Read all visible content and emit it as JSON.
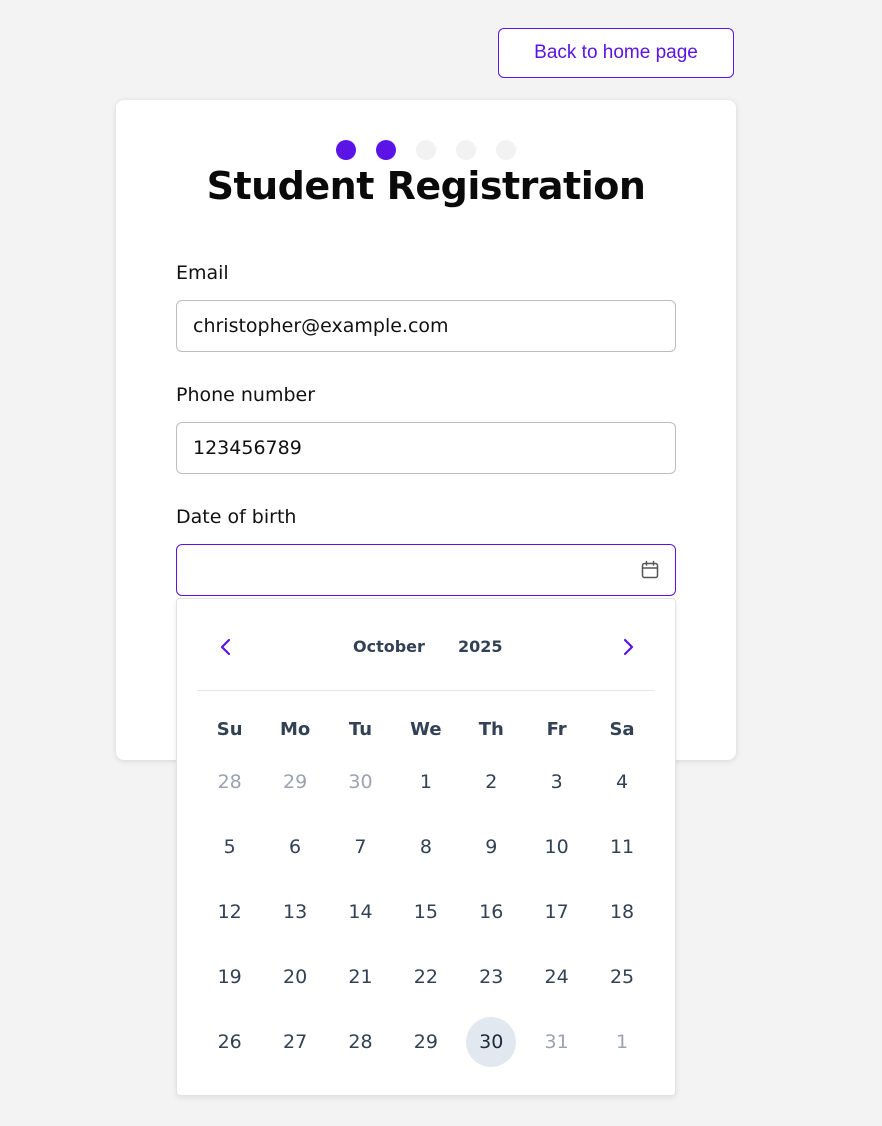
{
  "header": {
    "back_button_label": "Back to home page"
  },
  "form": {
    "title": "Student Registration",
    "steps_total": 5,
    "steps_completed": 2,
    "email": {
      "label": "Email",
      "value": "christopher@example.com"
    },
    "phone": {
      "label": "Phone number",
      "value": "123456789"
    },
    "dob": {
      "label": "Date of birth",
      "value": ""
    }
  },
  "datepicker": {
    "month": "October",
    "year": "2025",
    "prev_icon": "chevron-left-icon",
    "next_icon": "chevron-right-icon",
    "weekdays": [
      "Su",
      "Mo",
      "Tu",
      "We",
      "Th",
      "Fr",
      "Sa"
    ],
    "weeks": [
      [
        {
          "d": "28",
          "muted": true
        },
        {
          "d": "29",
          "muted": true
        },
        {
          "d": "30",
          "muted": true
        },
        {
          "d": "1"
        },
        {
          "d": "2"
        },
        {
          "d": "3"
        },
        {
          "d": "4"
        }
      ],
      [
        {
          "d": "5"
        },
        {
          "d": "6"
        },
        {
          "d": "7"
        },
        {
          "d": "8"
        },
        {
          "d": "9"
        },
        {
          "d": "10"
        },
        {
          "d": "11"
        }
      ],
      [
        {
          "d": "12"
        },
        {
          "d": "13"
        },
        {
          "d": "14"
        },
        {
          "d": "15"
        },
        {
          "d": "16"
        },
        {
          "d": "17"
        },
        {
          "d": "18"
        }
      ],
      [
        {
          "d": "19"
        },
        {
          "d": "20"
        },
        {
          "d": "21"
        },
        {
          "d": "22"
        },
        {
          "d": "23"
        },
        {
          "d": "24"
        },
        {
          "d": "25"
        }
      ],
      [
        {
          "d": "26"
        },
        {
          "d": "27"
        },
        {
          "d": "28"
        },
        {
          "d": "29"
        },
        {
          "d": "30",
          "today": true
        },
        {
          "d": "31",
          "muted": true
        },
        {
          "d": "1",
          "muted": true
        }
      ]
    ]
  },
  "colors": {
    "accent": "#5b14e6",
    "background": "#f3f3f3",
    "today_bg": "#e2e8f0",
    "text_dark": "#334155",
    "text_muted": "#9ca3af"
  }
}
